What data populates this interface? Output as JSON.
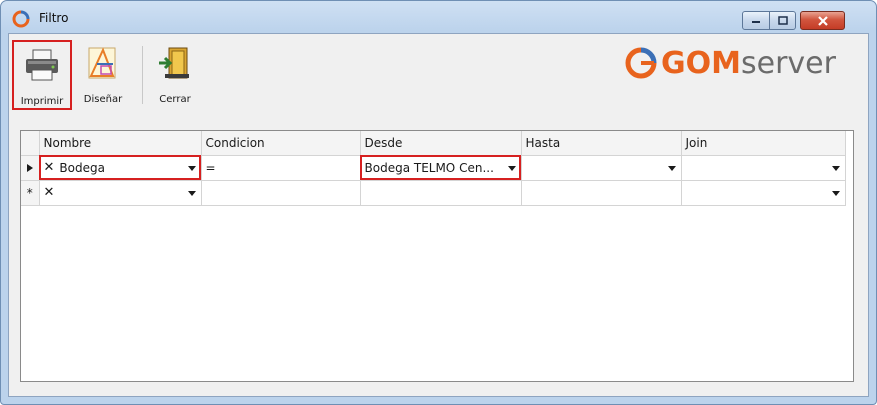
{
  "window": {
    "title": "Filtro"
  },
  "toolbar": {
    "print_label": "Imprimir",
    "design_label": "Diseñar",
    "close_label": "Cerrar"
  },
  "logo": {
    "brand_part1": "GOM",
    "brand_part2": "server"
  },
  "grid": {
    "columns": [
      "Nombre",
      "Condicion",
      "Desde",
      "Hasta",
      "Join"
    ],
    "rows": [
      {
        "nombre": "Bodega",
        "condicion": "=",
        "desde": "Bodega TELMO Cen...",
        "hasta": "",
        "join": ""
      },
      {
        "nombre": "",
        "condicion": "",
        "desde": "",
        "hasta": "",
        "join": ""
      }
    ],
    "new_row_marker": "*"
  },
  "colors": {
    "accent": "#e8631d",
    "highlight": "#d62020",
    "title_bar": "#bcd3ec"
  }
}
